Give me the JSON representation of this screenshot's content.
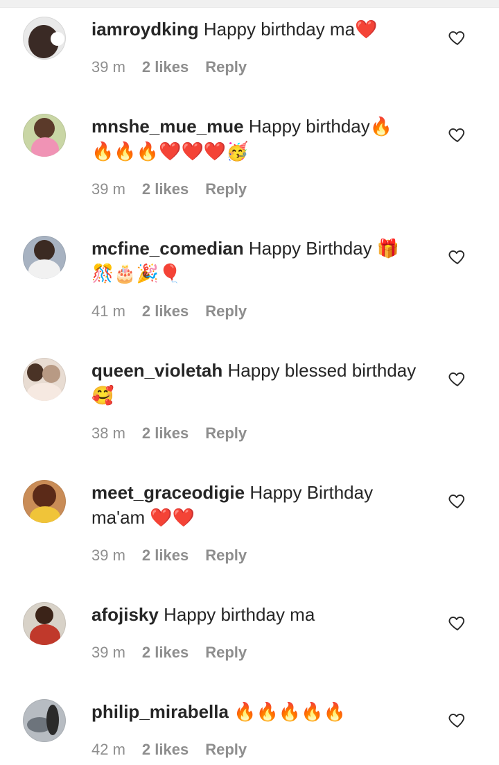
{
  "comments": [
    {
      "username": "iamroydking",
      "text": "Happy birthday ma❤️",
      "time": "39 m",
      "likes": "2 likes",
      "reply": "Reply"
    },
    {
      "username": "mnshe_mue_mue",
      "text": "Happy birthday🔥 🔥🔥🔥❤️❤️❤️🥳",
      "time": "39 m",
      "likes": "2 likes",
      "reply": "Reply"
    },
    {
      "username": "mcfine_comedian",
      "text": "Happy Birthday 🎁 🎊🎂🎉🎈",
      "time": "41 m",
      "likes": "2 likes",
      "reply": "Reply"
    },
    {
      "username": "queen_violetah",
      "text": "Happy blessed birthday 🥰",
      "time": "38 m",
      "likes": "2 likes",
      "reply": "Reply"
    },
    {
      "username": "meet_graceodigie",
      "text": "Happy Birthday ma'am ❤️❤️",
      "time": "39 m",
      "likes": "2 likes",
      "reply": "Reply"
    },
    {
      "username": "afojisky",
      "text": "Happy birthday ma",
      "time": "39 m",
      "likes": "2 likes",
      "reply": "Reply"
    },
    {
      "username": "philip_mirabella",
      "text": "🔥🔥🔥🔥🔥",
      "time": "42 m",
      "likes": "2 likes",
      "reply": "Reply"
    }
  ],
  "icons": {
    "like": "heart-outline-icon"
  },
  "colors": {
    "meta_text": "#8e8e8e",
    "username": "#262626"
  }
}
